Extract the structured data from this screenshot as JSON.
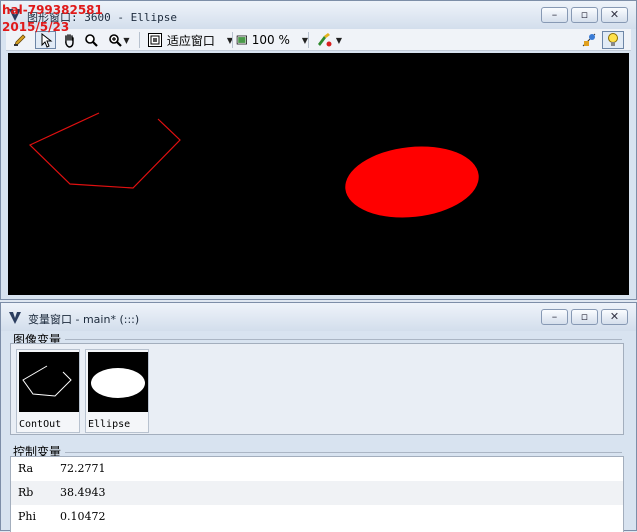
{
  "watermark": {
    "line1": "hal-799382581",
    "line2": "2015/5/23"
  },
  "graphics_window": {
    "title": "图形窗口: 3600 - Ellipse",
    "toolbar": {
      "fit_label": "适应窗口",
      "zoom_label": "100 %"
    },
    "colors": {
      "canvas": "#000000",
      "contour": "#ff0000",
      "ellipse": "#ff0000"
    }
  },
  "variable_window": {
    "title": "变量窗口 - main* (:::)",
    "image_group_label": "图像变量",
    "images": [
      {
        "name": "ContOut",
        "icon": "contour-thumbnail"
      },
      {
        "name": "Ellipse",
        "icon": "ellipse-thumbnail"
      }
    ],
    "control_group_label": "控制变量",
    "controls": [
      {
        "name": "Ra",
        "value": "72.2771"
      },
      {
        "name": "Rb",
        "value": "38.4943"
      },
      {
        "name": "Phi",
        "value": "0.10472"
      }
    ]
  }
}
